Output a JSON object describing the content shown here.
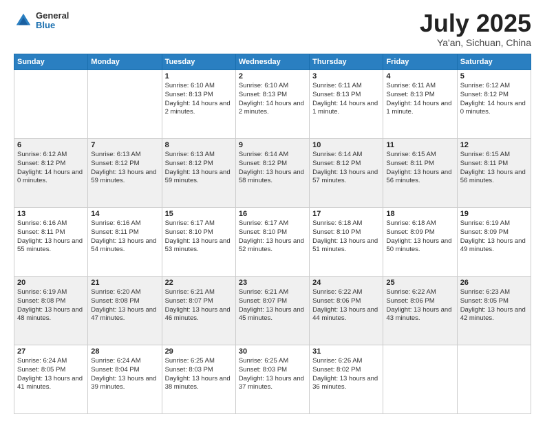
{
  "header": {
    "logo_general": "General",
    "logo_blue": "Blue",
    "title": "July 2025",
    "location": "Ya'an, Sichuan, China"
  },
  "days_of_week": [
    "Sunday",
    "Monday",
    "Tuesday",
    "Wednesday",
    "Thursday",
    "Friday",
    "Saturday"
  ],
  "weeks": [
    [
      null,
      null,
      {
        "day": "1",
        "sunrise": "Sunrise: 6:10 AM",
        "sunset": "Sunset: 8:13 PM",
        "daylight": "Daylight: 14 hours and 2 minutes."
      },
      {
        "day": "2",
        "sunrise": "Sunrise: 6:10 AM",
        "sunset": "Sunset: 8:13 PM",
        "daylight": "Daylight: 14 hours and 2 minutes."
      },
      {
        "day": "3",
        "sunrise": "Sunrise: 6:11 AM",
        "sunset": "Sunset: 8:13 PM",
        "daylight": "Daylight: 14 hours and 1 minute."
      },
      {
        "day": "4",
        "sunrise": "Sunrise: 6:11 AM",
        "sunset": "Sunset: 8:13 PM",
        "daylight": "Daylight: 14 hours and 1 minute."
      },
      {
        "day": "5",
        "sunrise": "Sunrise: 6:12 AM",
        "sunset": "Sunset: 8:12 PM",
        "daylight": "Daylight: 14 hours and 0 minutes."
      }
    ],
    [
      {
        "day": "6",
        "sunrise": "Sunrise: 6:12 AM",
        "sunset": "Sunset: 8:12 PM",
        "daylight": "Daylight: 14 hours and 0 minutes."
      },
      {
        "day": "7",
        "sunrise": "Sunrise: 6:13 AM",
        "sunset": "Sunset: 8:12 PM",
        "daylight": "Daylight: 13 hours and 59 minutes."
      },
      {
        "day": "8",
        "sunrise": "Sunrise: 6:13 AM",
        "sunset": "Sunset: 8:12 PM",
        "daylight": "Daylight: 13 hours and 59 minutes."
      },
      {
        "day": "9",
        "sunrise": "Sunrise: 6:14 AM",
        "sunset": "Sunset: 8:12 PM",
        "daylight": "Daylight: 13 hours and 58 minutes."
      },
      {
        "day": "10",
        "sunrise": "Sunrise: 6:14 AM",
        "sunset": "Sunset: 8:12 PM",
        "daylight": "Daylight: 13 hours and 57 minutes."
      },
      {
        "day": "11",
        "sunrise": "Sunrise: 6:15 AM",
        "sunset": "Sunset: 8:11 PM",
        "daylight": "Daylight: 13 hours and 56 minutes."
      },
      {
        "day": "12",
        "sunrise": "Sunrise: 6:15 AM",
        "sunset": "Sunset: 8:11 PM",
        "daylight": "Daylight: 13 hours and 56 minutes."
      }
    ],
    [
      {
        "day": "13",
        "sunrise": "Sunrise: 6:16 AM",
        "sunset": "Sunset: 8:11 PM",
        "daylight": "Daylight: 13 hours and 55 minutes."
      },
      {
        "day": "14",
        "sunrise": "Sunrise: 6:16 AM",
        "sunset": "Sunset: 8:11 PM",
        "daylight": "Daylight: 13 hours and 54 minutes."
      },
      {
        "day": "15",
        "sunrise": "Sunrise: 6:17 AM",
        "sunset": "Sunset: 8:10 PM",
        "daylight": "Daylight: 13 hours and 53 minutes."
      },
      {
        "day": "16",
        "sunrise": "Sunrise: 6:17 AM",
        "sunset": "Sunset: 8:10 PM",
        "daylight": "Daylight: 13 hours and 52 minutes."
      },
      {
        "day": "17",
        "sunrise": "Sunrise: 6:18 AM",
        "sunset": "Sunset: 8:10 PM",
        "daylight": "Daylight: 13 hours and 51 minutes."
      },
      {
        "day": "18",
        "sunrise": "Sunrise: 6:18 AM",
        "sunset": "Sunset: 8:09 PM",
        "daylight": "Daylight: 13 hours and 50 minutes."
      },
      {
        "day": "19",
        "sunrise": "Sunrise: 6:19 AM",
        "sunset": "Sunset: 8:09 PM",
        "daylight": "Daylight: 13 hours and 49 minutes."
      }
    ],
    [
      {
        "day": "20",
        "sunrise": "Sunrise: 6:19 AM",
        "sunset": "Sunset: 8:08 PM",
        "daylight": "Daylight: 13 hours and 48 minutes."
      },
      {
        "day": "21",
        "sunrise": "Sunrise: 6:20 AM",
        "sunset": "Sunset: 8:08 PM",
        "daylight": "Daylight: 13 hours and 47 minutes."
      },
      {
        "day": "22",
        "sunrise": "Sunrise: 6:21 AM",
        "sunset": "Sunset: 8:07 PM",
        "daylight": "Daylight: 13 hours and 46 minutes."
      },
      {
        "day": "23",
        "sunrise": "Sunrise: 6:21 AM",
        "sunset": "Sunset: 8:07 PM",
        "daylight": "Daylight: 13 hours and 45 minutes."
      },
      {
        "day": "24",
        "sunrise": "Sunrise: 6:22 AM",
        "sunset": "Sunset: 8:06 PM",
        "daylight": "Daylight: 13 hours and 44 minutes."
      },
      {
        "day": "25",
        "sunrise": "Sunrise: 6:22 AM",
        "sunset": "Sunset: 8:06 PM",
        "daylight": "Daylight: 13 hours and 43 minutes."
      },
      {
        "day": "26",
        "sunrise": "Sunrise: 6:23 AM",
        "sunset": "Sunset: 8:05 PM",
        "daylight": "Daylight: 13 hours and 42 minutes."
      }
    ],
    [
      {
        "day": "27",
        "sunrise": "Sunrise: 6:24 AM",
        "sunset": "Sunset: 8:05 PM",
        "daylight": "Daylight: 13 hours and 41 minutes."
      },
      {
        "day": "28",
        "sunrise": "Sunrise: 6:24 AM",
        "sunset": "Sunset: 8:04 PM",
        "daylight": "Daylight: 13 hours and 39 minutes."
      },
      {
        "day": "29",
        "sunrise": "Sunrise: 6:25 AM",
        "sunset": "Sunset: 8:03 PM",
        "daylight": "Daylight: 13 hours and 38 minutes."
      },
      {
        "day": "30",
        "sunrise": "Sunrise: 6:25 AM",
        "sunset": "Sunset: 8:03 PM",
        "daylight": "Daylight: 13 hours and 37 minutes."
      },
      {
        "day": "31",
        "sunrise": "Sunrise: 6:26 AM",
        "sunset": "Sunset: 8:02 PM",
        "daylight": "Daylight: 13 hours and 36 minutes."
      },
      null,
      null
    ]
  ]
}
